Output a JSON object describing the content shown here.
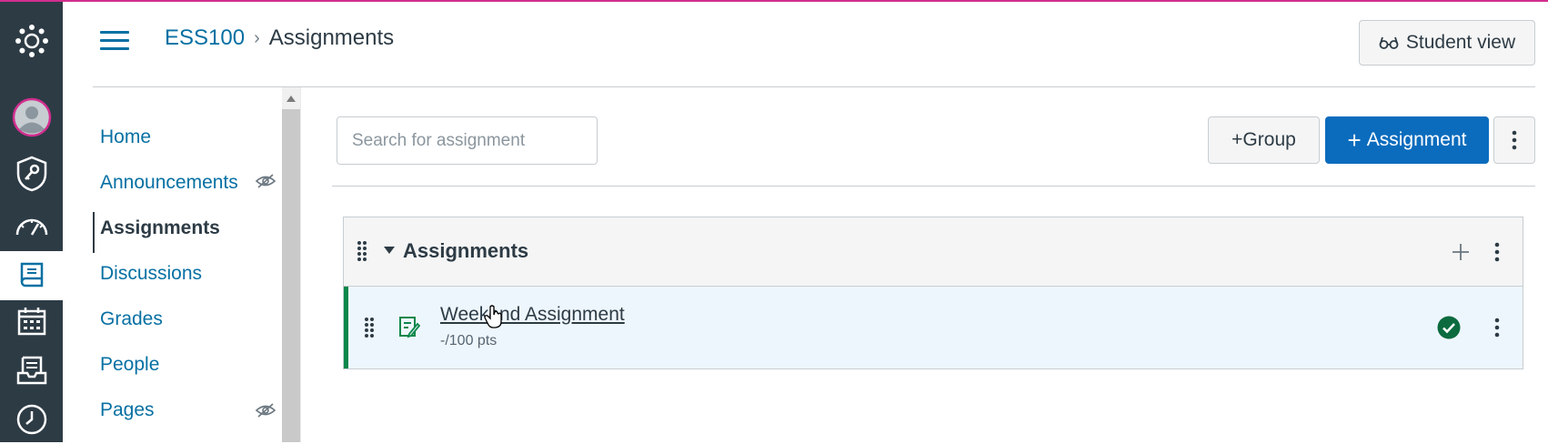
{
  "header": {
    "breadcrumb_course": "ESS100",
    "breadcrumb_separator": "›",
    "breadcrumb_current": "Assignments",
    "student_view_label": "Student view"
  },
  "global_nav": [
    {
      "icon": "logo-icon"
    },
    {
      "icon": "account-avatar-icon"
    },
    {
      "icon": "admin-shield-key-icon"
    },
    {
      "icon": "dashboard-gauge-icon"
    },
    {
      "icon": "courses-book-icon",
      "active": true
    },
    {
      "icon": "calendar-icon"
    },
    {
      "icon": "inbox-icon"
    },
    {
      "icon": "history-clock-icon"
    }
  ],
  "course_nav": {
    "items": [
      {
        "label": "Home"
      },
      {
        "label": "Announcements",
        "hidden_from_students": true
      },
      {
        "label": "Assignments",
        "active": true
      },
      {
        "label": "Discussions"
      },
      {
        "label": "Grades"
      },
      {
        "label": "People"
      },
      {
        "label": "Pages",
        "hidden_from_students": true
      }
    ]
  },
  "toolbar": {
    "search_placeholder": "Search for assignment",
    "search_value": "",
    "group_button": "+Group",
    "assignment_button": "Assignment",
    "assignment_button_prefix": "+"
  },
  "assignment_group": {
    "title": "Assignments",
    "items": [
      {
        "title": "Weekend Assignment",
        "points": "-/100 pts",
        "published": true
      }
    ]
  },
  "colors": {
    "accent": "#0770a3",
    "primary_button": "#0b6cbd",
    "published_green": "#0b874b",
    "rail": "#2d3b45",
    "top_strip": "#d12e8e"
  }
}
